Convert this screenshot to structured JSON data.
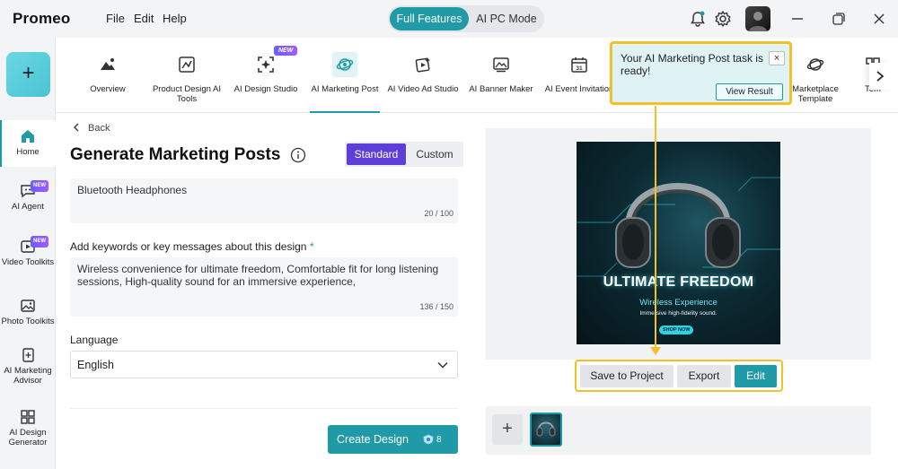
{
  "app": {
    "title": "Promeo",
    "menu": [
      "File",
      "Edit",
      "Help"
    ],
    "modes": {
      "active": "Full Features",
      "other": "AI PC Mode"
    }
  },
  "sidebar": {
    "items": [
      {
        "label": "Home",
        "icon": "home-icon",
        "active": true
      },
      {
        "label": "AI Agent",
        "icon": "ai-agent-icon",
        "badge": "NEW"
      },
      {
        "label": "Video Toolkits",
        "icon": "video-icon",
        "badge": "NEW"
      },
      {
        "label": "Photo Toolkits",
        "icon": "photo-icon"
      },
      {
        "label": "AI Marketing Advisor",
        "icon": "advisor-icon"
      },
      {
        "label": "AI Design Generator",
        "icon": "grid-icon"
      }
    ]
  },
  "tools": {
    "new_badge": "NEW",
    "items": [
      {
        "label": "Overview",
        "icon": "overview-icon"
      },
      {
        "label": "Product Design AI Tools",
        "icon": "product-design-icon"
      },
      {
        "label": "AI Design Studio",
        "icon": "design-studio-icon"
      },
      {
        "label": "AI Marketing Post",
        "icon": "marketing-post-icon",
        "active": true
      },
      {
        "label": "AI Video Ad Studio",
        "icon": "video-ad-icon"
      },
      {
        "label": "AI Banner Maker",
        "icon": "banner-icon"
      },
      {
        "label": "AI Event Invitation",
        "icon": "calendar-icon"
      },
      {
        "label": "Marketplace Template",
        "icon": "marketplace-icon"
      },
      {
        "label": "Tem",
        "icon": "template-icon"
      }
    ]
  },
  "form": {
    "back": "Back",
    "heading": "Generate Marketing Posts",
    "mode_standard": "Standard",
    "mode_custom": "Custom",
    "product_value": "Bluetooth Headphones",
    "product_count": "20 / 100",
    "keywords_label": "Add keywords or key messages about this design",
    "keywords_required": "*",
    "keywords_value": "Wireless convenience for ultimate freedom, Comfortable fit for long listening sessions, High-quality sound for an immersive experience,",
    "keywords_count": "136 / 150",
    "language_label": "Language",
    "language_value": "English",
    "create_label": "Create Design",
    "credits": "8"
  },
  "preview": {
    "title": "ULTIMATE FREEDOM",
    "subtitle": "Wireless Experience",
    "tagline": "Immersive high-fidelity sound.",
    "cta": "SHOP NOW",
    "actions": {
      "save": "Save to Project",
      "export": "Export",
      "edit": "Edit"
    },
    "add_label": "+"
  },
  "notification": {
    "text": "Your AI Marketing Post task is ready!",
    "button": "View Result",
    "close": "×"
  },
  "colors": {
    "accent": "#1f9aa6",
    "purple": "#5b3fd6",
    "highlight": "#f3c02a"
  }
}
